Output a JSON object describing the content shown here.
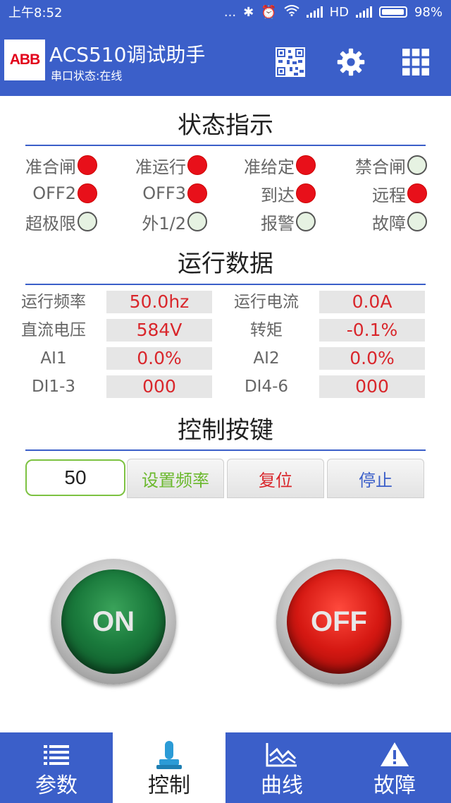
{
  "status_bar": {
    "time": "上午8:52",
    "dots": "...",
    "network": "HD",
    "battery": "98%",
    "battery_level": 0.98
  },
  "header": {
    "logo_text": "ABB",
    "title": "ACS510调试助手",
    "subtitle": "串口状态:在线",
    "icons": [
      "qr-code-icon",
      "gear-icon",
      "grid-menu-icon"
    ]
  },
  "status_section": {
    "title": "状态指示",
    "indicators": [
      {
        "label": "准合闸",
        "on": true
      },
      {
        "label": "准运行",
        "on": true
      },
      {
        "label": "准给定",
        "on": true
      },
      {
        "label": "禁合闸",
        "on": false
      },
      {
        "label": "OFF2",
        "on": true
      },
      {
        "label": "OFF3",
        "on": true
      },
      {
        "label": "到达",
        "on": true
      },
      {
        "label": "远程",
        "on": true
      },
      {
        "label": "超极限",
        "on": false
      },
      {
        "label": "外1/2",
        "on": false
      },
      {
        "label": "报警",
        "on": false
      },
      {
        "label": "故障",
        "on": false
      }
    ],
    "colors": {
      "on": "#e8101a",
      "off": "#e6f2e2"
    }
  },
  "run_data": {
    "title": "运行数据",
    "rows": [
      [
        {
          "label": "运行频率",
          "value": "50.0hz"
        },
        {
          "label": "运行电流",
          "value": "0.0A"
        }
      ],
      [
        {
          "label": "直流电压",
          "value": "584V"
        },
        {
          "label": "转矩",
          "value": "-0.1%"
        }
      ],
      [
        {
          "label": "AI1",
          "value": "0.0%"
        },
        {
          "label": "AI2",
          "value": "0.0%"
        }
      ],
      [
        {
          "label": "DI1-3",
          "value": "000"
        },
        {
          "label": "DI4-6",
          "value": "000"
        }
      ]
    ]
  },
  "controls": {
    "title": "控制按键",
    "freq_value": "50",
    "set_freq_label": "设置频率",
    "reset_label": "复位",
    "stop_label": "停止",
    "on_label": "ON",
    "off_label": "OFF",
    "colors": {
      "set_freq": "#6ab82c",
      "reset": "#d9262b",
      "stop": "#3b5fc9"
    }
  },
  "bottom_nav": {
    "items": [
      {
        "label": "参数",
        "icon": "list-icon",
        "active": false
      },
      {
        "label": "控制",
        "icon": "joystick-icon",
        "active": true
      },
      {
        "label": "曲线",
        "icon": "line-chart-icon",
        "active": false
      },
      {
        "label": "故障",
        "icon": "warning-icon",
        "active": false
      }
    ]
  },
  "theme": {
    "primary": "#3b5fc9",
    "accent_red": "#d9262b"
  }
}
